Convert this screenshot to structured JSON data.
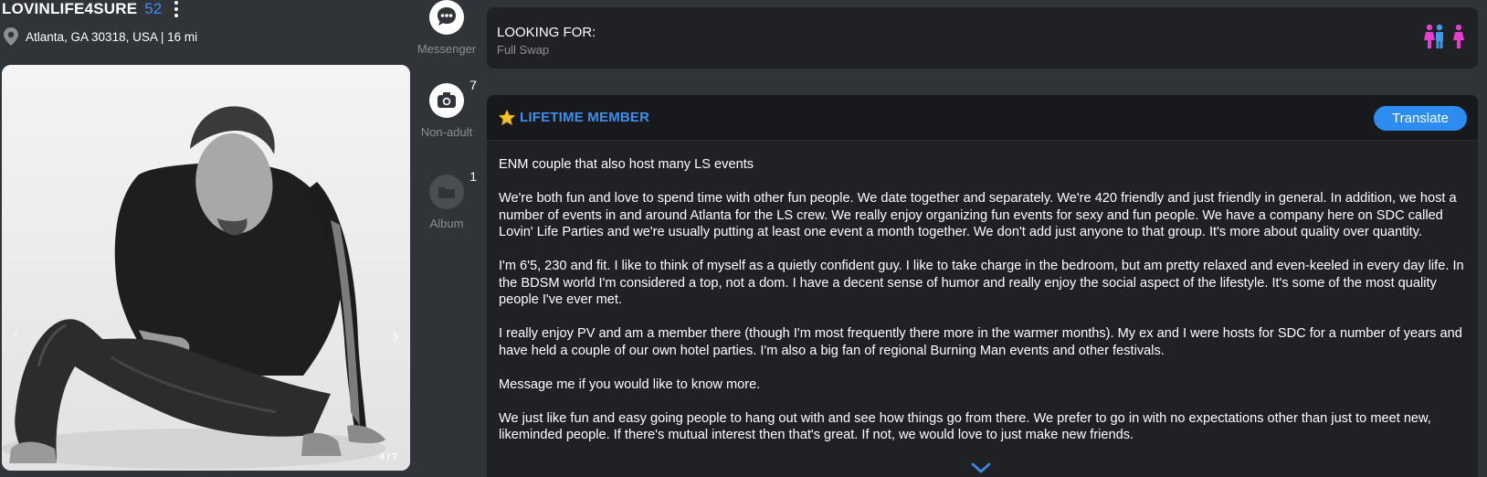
{
  "profile": {
    "username": "LOVINLIFE4SURE",
    "age": "52",
    "location": "Atlanta, GA 30318, USA | 16 mi"
  },
  "photo": {
    "counter": "4 / 7",
    "prev_icon": "chevron-left-icon",
    "next_icon": "chevron-right-icon"
  },
  "side_icons": [
    {
      "icon": "messenger-icon",
      "label": "Messenger",
      "count": ""
    },
    {
      "icon": "camera-icon",
      "label": "Non-adult",
      "count": "7"
    },
    {
      "icon": "folder-icon",
      "label": "Album",
      "count": "1"
    }
  ],
  "looking_for": {
    "title": "LOOKING FOR:",
    "value": "Full Swap",
    "icon": "couple-people-icon"
  },
  "about": {
    "badge": "LIFETIME MEMBER",
    "translate_label": "Translate",
    "paragraphs": [
      "ENM couple that also host many LS events",
      "We're both fun and love to spend time with other fun people. We date together and separately. We're 420 friendly and just friendly in general. In addition, we host a number of events in and around Atlanta for the LS crew. We really enjoy organizing fun events for sexy and fun people. We have a company here on SDC called Lovin' Life Parties and we're usually putting at least one event a month together. We don't add just anyone to that group. It's more about quality over quantity.",
      "I'm 6'5, 230 and fit. I like to think of myself as a quietly confident guy. I like to take charge in the bedroom, but am pretty relaxed and even-keeled in every day life. In the BDSM world I'm considered a top, not a dom. I have a decent sense of humor and really enjoy the social aspect of the lifestyle. It's some of the most quality people I've ever met.",
      "I really enjoy PV and am a member there (though I'm most frequently there more in the warmer months). My ex and I were hosts for SDC for a number of years and have held a couple of our own hotel parties. I'm also a big fan of regional Burning Man events and other festivals.",
      "Message me if you would like to know more.",
      "We just like fun and easy going people to hang out with and see how things go from there. We prefer to go in with no expectations other than just to meet new, likeminded people. If there's mutual interest then that's great. If not, we would love to just make new friends."
    ]
  },
  "colors": {
    "background": "#303338",
    "card": "#1f2125",
    "accent": "#3d8ff0",
    "translate_button": "#2d8cf0",
    "couple_pink": "#e23fd0",
    "couple_blue": "#3f9ae8"
  }
}
